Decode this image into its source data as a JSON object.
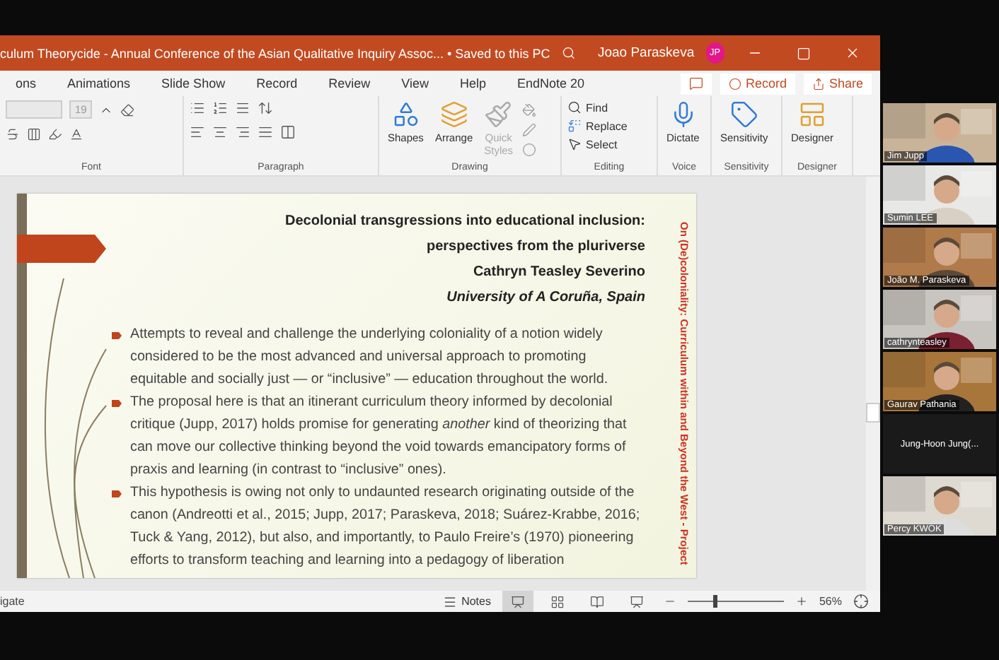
{
  "window": {
    "title": "culum Theorycide - Annual Conference of the Asian Qualitative Inquiry Assoc... • Saved to this PC",
    "user": "Joao Paraskeva",
    "avatar": "JP"
  },
  "tabs": [
    "ons",
    "Animations",
    "Slide Show",
    "Record",
    "Review",
    "View",
    "Help",
    "EndNote 20"
  ],
  "actions": [
    {
      "kind": "comment"
    },
    {
      "kind": "record",
      "label": "Record"
    },
    {
      "kind": "share",
      "label": "Share"
    }
  ],
  "ribbon": [
    {
      "kind": "font",
      "label": "Font",
      "font_size": "19"
    },
    {
      "kind": "paragraph",
      "label": "Paragraph"
    },
    {
      "kind": "big",
      "label": "Drawing",
      "buttons": [
        {
          "kind": "shapes",
          "label": "Shapes",
          "disabled": false
        },
        {
          "kind": "arrange",
          "label": "Arrange",
          "disabled": false
        },
        {
          "kind": "styles",
          "label": "Quick Styles",
          "disabled": true
        }
      ]
    },
    {
      "kind": "editing",
      "label": "Editing",
      "buttons": [
        {
          "kind": "find",
          "label": "Find"
        },
        {
          "kind": "replace",
          "label": "Replace"
        },
        {
          "kind": "select",
          "label": "Select"
        }
      ]
    },
    {
      "kind": "big",
      "label": "Voice",
      "buttons": [
        {
          "kind": "dictate",
          "label": "Dictate",
          "disabled": false
        }
      ]
    },
    {
      "kind": "big",
      "label": "Sensitivity",
      "buttons": [
        {
          "kind": "sensitivity",
          "label": "Sensitivity",
          "disabled": false
        }
      ]
    },
    {
      "kind": "big",
      "label": "Designer",
      "buttons": [
        {
          "kind": "designer",
          "label": "Designer",
          "disabled": false
        }
      ]
    }
  ],
  "slide": {
    "title_lines": [
      {
        "text": "Decolonial transgressions into educational inclusion:",
        "italic": false
      },
      {
        "text": "perspectives from the pluriverse",
        "italic": false
      },
      {
        "text": "Cathryn Teasley Severino",
        "italic": false
      },
      {
        "text": "University of A Coruña, Spain",
        "italic": true
      }
    ],
    "bullets": [
      "Attempts to reveal and challenge the underlying coloniality of a notion widely considered to be the most advanced and universal approach to promoting equitable and socially just — or “inclusive” — education throughout the world.",
      "The proposal here is that an itinerant curriculum theory informed by decolonial critique (Jupp, 2017) holds promise for generating *another* kind of theorizing that can move our collective thinking beyond the void towards emancipatory forms of praxis and learning (in contrast to “inclusive” ones).",
      "This hypothesis is owing not only to undaunted research originating outside of the canon (Andreotti et al., 2015; Jupp, 2017; Paraskeva, 2018; Suárez-Krabbe, 2016; Tuck & Yang, 2012), but also, and importantly, to Paulo Freire’s (1970) pioneering efforts to transform teaching and learning into a pedagogy of liberation"
    ],
    "side_text": "On (De)coloniality: Curriculum within and Beyond the West - Project"
  },
  "status_bar": {
    "text": "igate",
    "notes": "Notes",
    "views": [
      {
        "selected": true
      },
      {
        "selected": false
      },
      {
        "selected": false
      },
      {
        "selected": false
      }
    ],
    "zoom": {
      "level": 0.27,
      "reading": "56%"
    }
  },
  "participants": [
    {
      "name": "Jim Jupp",
      "video": true
    },
    {
      "name": "Sumin LEE",
      "video": true
    },
    {
      "name": "João M. Paraskeva",
      "video": true
    },
    {
      "name": "cathrynteasley",
      "video": true
    },
    {
      "name": "Gaurav Pathania",
      "video": true
    },
    {
      "name": "Jung-Hoon Jung(...",
      "video": false
    },
    {
      "name": "Percy KWOK",
      "video": true
    }
  ]
}
